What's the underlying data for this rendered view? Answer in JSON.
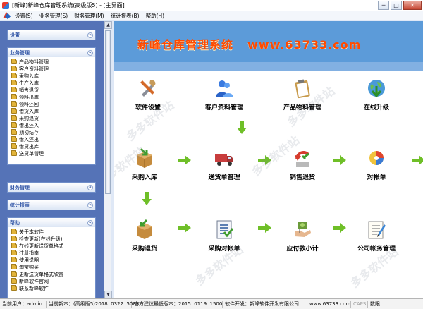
{
  "window": {
    "title": "[新峰]新峰仓库管理系统(高级版5) - [主界面]",
    "buttons": {
      "minimize": "─",
      "restore": "□",
      "close": "✕"
    }
  },
  "menu": [
    "设置(S)",
    "业务管理(S)",
    "财务管理(M)",
    "统计报表(B)",
    "帮助(H)"
  ],
  "sidebar": {
    "settings": {
      "title": "设置"
    },
    "business": {
      "title": "业务管理",
      "items": [
        "产品物料管理",
        "客户资料管理",
        "采购入库",
        "生产入库",
        "销售退货",
        "领料出库",
        "领料还回",
        "借货入库",
        "采购退货",
        "借出还入",
        "期初结存",
        "借入还出",
        "借货出库",
        "送货单管理"
      ]
    },
    "finance": {
      "title": "财务管理"
    },
    "reports": {
      "title": "统计报表"
    },
    "help": {
      "title": "帮助",
      "items": [
        "关于本软件",
        "检查更新(在线升级)",
        "在线更新送货单格式",
        "注册指南",
        "使用说明",
        "淘宝购买",
        "更新送货单格式欣赏",
        "新峰软件官网",
        "联系新峰软件"
      ]
    },
    "chevron": "«",
    "scroll_up": "▲",
    "scroll_down": "▼"
  },
  "main": {
    "banner_title": "新峰仓库管理系统",
    "banner_url": "www.63733.com",
    "functions": {
      "software_settings": "软件设置",
      "customer_management": "客户资料管理",
      "product_management": "产品物料管理",
      "online_upgrade": "在线升级",
      "purchase_in": "采购入库",
      "delivery_order": "送货单管理",
      "sales_return": "销售退货",
      "statement": "对帐单",
      "purchase_return": "采购退货",
      "purchase_statement": "采购对帐单",
      "payable_summary": "应付款小计",
      "company_accounts": "公司帐务管理"
    }
  },
  "status": {
    "user": "当前用户：admin",
    "version": "当前新本：(高级版5)2018. 0322. 5085",
    "recommend": "官方建议最低版本：2015. 0119. 1500",
    "developer": "软件开发：新峰软件开发有限公司",
    "website": "www.63733.com",
    "caps": "CAPS",
    "num": "数限"
  },
  "watermark": "多多软件站"
}
